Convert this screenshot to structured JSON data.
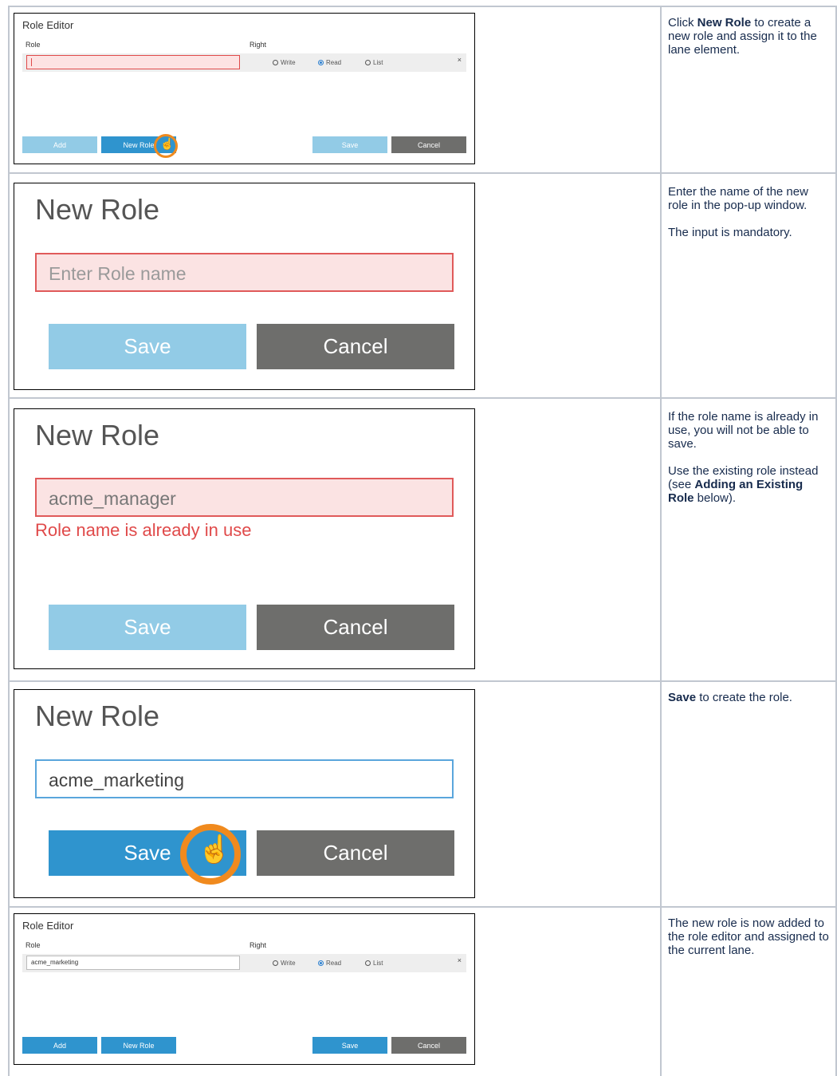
{
  "rows": [
    {
      "instruction": {
        "paragraphs": [
          {
            "parts": [
              {
                "t": "Click ",
                "b": false
              },
              {
                "t": "New Role",
                "b": true
              },
              {
                "t": " to create a new role and assign it to the lane element.",
                "b": false
              }
            ]
          }
        ]
      },
      "screen": {
        "title": "Role Editor",
        "role_header": "Role",
        "right_header": "Right",
        "role_value": "",
        "radios": [
          "Write",
          "Read",
          "List"
        ],
        "selected": "Read",
        "remove_icon": "×",
        "buttons": {
          "add": "Add",
          "new_role": "New Role",
          "save": "Save",
          "cancel": "Cancel"
        }
      }
    },
    {
      "instruction": {
        "paragraphs": [
          {
            "parts": [
              {
                "t": "Enter the name of the new role in the pop-up window.",
                "b": false
              }
            ]
          },
          {
            "parts": [
              {
                "t": "The input is mandatory.",
                "b": false
              }
            ]
          }
        ]
      },
      "screen": {
        "title": "New Role",
        "input_placeholder": "Enter Role name",
        "buttons": {
          "save": "Save",
          "cancel": "Cancel"
        }
      }
    },
    {
      "instruction": {
        "paragraphs": [
          {
            "parts": [
              {
                "t": "If the role name is already in use, you will not be able to save.",
                "b": false
              }
            ]
          },
          {
            "parts": [
              {
                "t": "Use the existing role instead (see ",
                "b": false
              },
              {
                "t": "Adding an Existing Role",
                "b": true
              },
              {
                "t": " below).",
                "b": false
              }
            ]
          }
        ]
      },
      "screen": {
        "title": "New Role",
        "input_value": "acme_manager",
        "error": "Role name is already in use",
        "buttons": {
          "save": "Save",
          "cancel": "Cancel"
        }
      }
    },
    {
      "instruction": {
        "paragraphs": [
          {
            "parts": [
              {
                "t": "Save",
                "b": true
              },
              {
                "t": " to create the role.",
                "b": false
              }
            ]
          }
        ]
      },
      "screen": {
        "title": "New Role",
        "input_value": "acme_marketing",
        "buttons": {
          "save": "Save",
          "cancel": "Cancel"
        }
      }
    },
    {
      "instruction": {
        "paragraphs": [
          {
            "parts": [
              {
                "t": "The new role is now added to the role editor and assigned to the current lane.",
                "b": false
              }
            ]
          }
        ]
      },
      "screen": {
        "title": "Role Editor",
        "role_header": "Role",
        "right_header": "Right",
        "role_value": "acme_marketing",
        "radios": [
          "Write",
          "Read",
          "List"
        ],
        "selected": "Read",
        "remove_icon": "×",
        "buttons": {
          "add": "Add",
          "new_role": "New Role",
          "save": "Save",
          "cancel": "Cancel"
        }
      }
    }
  ],
  "colors": {
    "light_blue": "#92cbe6",
    "blue": "#2f94ce",
    "gray": "#6e6e6c",
    "error_red": "#e04a4a",
    "highlight": "#f08a1e"
  },
  "icons": {
    "cursor": "pointer-hand-icon",
    "highlight": "click-highlight-ring"
  }
}
